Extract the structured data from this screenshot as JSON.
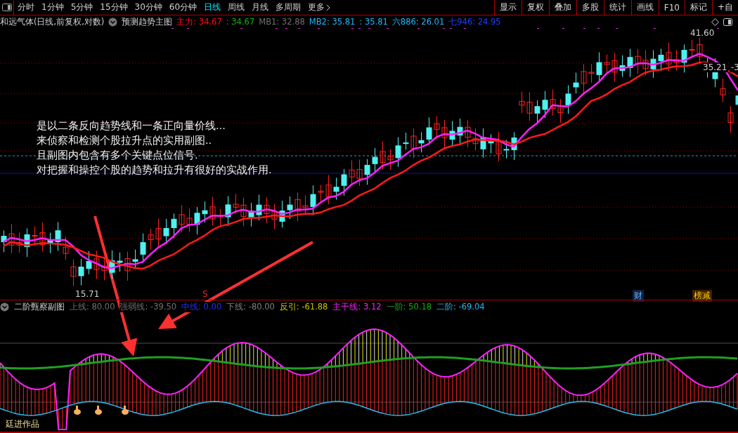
{
  "toolbar": {
    "periods": [
      {
        "label": "分时",
        "selected": false
      },
      {
        "label": "1分钟",
        "selected": false
      },
      {
        "label": "5分钟",
        "selected": false
      },
      {
        "label": "15分钟",
        "selected": false
      },
      {
        "label": "30分钟",
        "selected": false
      },
      {
        "label": "60分钟",
        "selected": false
      },
      {
        "label": "日线",
        "selected": true
      },
      {
        "label": "周线",
        "selected": false
      },
      {
        "label": "月线",
        "selected": false
      },
      {
        "label": "多周期",
        "selected": false
      },
      {
        "label": "更多",
        "selected": false
      }
    ],
    "buttons": [
      "显示",
      "复权",
      "叠加",
      "多股",
      "统计",
      "画线",
      "F10",
      "标记",
      "+自"
    ]
  },
  "main_legend": {
    "stock": "和远气体(日线,前复权,对数)",
    "indicator": "预测趋势主图",
    "values": [
      {
        "text": "主力: 34.67",
        "color": "#ff1010"
      },
      {
        "text": ": 34.67",
        "color": "#10b010"
      },
      {
        "text": "MB1: 32.88",
        "color": "#707070"
      },
      {
        "text": "MB2: 35.81",
        "color": "#20b8f8"
      },
      {
        "text": ": 35.81",
        "color": "#20b8f8"
      },
      {
        "text": "六886: 26.01",
        "color": "#20b8f8"
      },
      {
        "text": "七946: 24.95",
        "color": "#2040ff"
      }
    ]
  },
  "main_chart": {
    "annotation": [
      "是以二条反向趋势线和一条正向量价线...",
      "来侦察和检测个股拉升点的实用副图..",
      "且副图内包含有多个关键点位信号.",
      "对把握和操控个股的趋势和拉升有很好的实战作用."
    ],
    "high_label": "41.60",
    "low_label": "15.71",
    "last_label": "35.21",
    "edge_label": "-3",
    "markers": [
      {
        "text": "S",
        "kind": "signal"
      },
      {
        "text": "财",
        "kind": "finance"
      },
      {
        "text": "榜减",
        "kind": "event"
      }
    ]
  },
  "sub_legend": {
    "title": "二阶甄察副图",
    "values": [
      {
        "text": "上线: 80.00",
        "color": "#707070"
      },
      {
        "text": "强弱线: -39.50",
        "color": "#707070"
      },
      {
        "text": "中线: 0.00",
        "color": "#2030ff"
      },
      {
        "text": "下线: -80.00",
        "color": "#808080"
      },
      {
        "text": "反引: -61.88",
        "color": "#c8c000"
      },
      {
        "text": "主干线: 3.12",
        "color": "#ff20ff"
      },
      {
        "text": "一阶: 50.18",
        "color": "#10b010"
      },
      {
        "text": "二阶: -69.04",
        "color": "#20b8f8"
      }
    ]
  },
  "footer": "廷进作品"
}
